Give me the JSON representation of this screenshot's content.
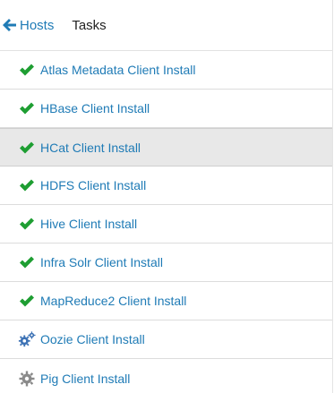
{
  "header": {
    "back_label": "Hosts",
    "title": "Tasks"
  },
  "colors": {
    "link": "#1f7bb6",
    "success": "#1e9e32",
    "gears": "#3d72b5",
    "pending": "#8a8a8a",
    "selected_row": "#e8e8e8"
  },
  "tasks": [
    {
      "label": "Atlas Metadata Client Install",
      "status_icon": "check-icon"
    },
    {
      "label": "HBase Client Install",
      "status_icon": "check-icon"
    },
    {
      "label": "HCat Client Install",
      "status_icon": "check-icon",
      "selected": true
    },
    {
      "label": "HDFS Client Install",
      "status_icon": "check-icon"
    },
    {
      "label": "Hive Client Install",
      "status_icon": "check-icon"
    },
    {
      "label": "Infra Solr Client Install",
      "status_icon": "check-icon"
    },
    {
      "label": "MapReduce2 Client Install",
      "status_icon": "check-icon"
    },
    {
      "label": "Oozie Client Install",
      "status_icon": "gears-icon"
    },
    {
      "label": "Pig Client Install",
      "status_icon": "gear-icon"
    }
  ]
}
